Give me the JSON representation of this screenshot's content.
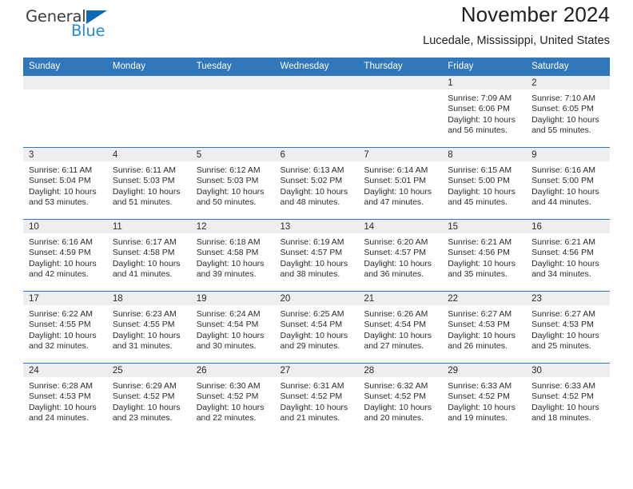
{
  "brand": {
    "word_one": "General",
    "word_two": "Blue",
    "triangle_color": "#0f6ab4",
    "blue_color": "#2a8bd5"
  },
  "header": {
    "title": "November 2024",
    "subtitle": "Lucedale, Mississippi, United States"
  },
  "theme": {
    "header_bar_color": "#3077bc",
    "daynum_bar_color": "#eeeeee",
    "row_border_color": "#2f76bb"
  },
  "calendar": {
    "day_headers": [
      "Sunday",
      "Monday",
      "Tuesday",
      "Wednesday",
      "Thursday",
      "Friday",
      "Saturday"
    ],
    "weeks": [
      [
        {
          "day": "",
          "sunrise": "",
          "sunset": "",
          "daylight": ""
        },
        {
          "day": "",
          "sunrise": "",
          "sunset": "",
          "daylight": ""
        },
        {
          "day": "",
          "sunrise": "",
          "sunset": "",
          "daylight": ""
        },
        {
          "day": "",
          "sunrise": "",
          "sunset": "",
          "daylight": ""
        },
        {
          "day": "",
          "sunrise": "",
          "sunset": "",
          "daylight": ""
        },
        {
          "day": "1",
          "sunrise": "Sunrise: 7:09 AM",
          "sunset": "Sunset: 6:06 PM",
          "daylight": "Daylight: 10 hours and 56 minutes."
        },
        {
          "day": "2",
          "sunrise": "Sunrise: 7:10 AM",
          "sunset": "Sunset: 6:05 PM",
          "daylight": "Daylight: 10 hours and 55 minutes."
        }
      ],
      [
        {
          "day": "3",
          "sunrise": "Sunrise: 6:11 AM",
          "sunset": "Sunset: 5:04 PM",
          "daylight": "Daylight: 10 hours and 53 minutes."
        },
        {
          "day": "4",
          "sunrise": "Sunrise: 6:11 AM",
          "sunset": "Sunset: 5:03 PM",
          "daylight": "Daylight: 10 hours and 51 minutes."
        },
        {
          "day": "5",
          "sunrise": "Sunrise: 6:12 AM",
          "sunset": "Sunset: 5:03 PM",
          "daylight": "Daylight: 10 hours and 50 minutes."
        },
        {
          "day": "6",
          "sunrise": "Sunrise: 6:13 AM",
          "sunset": "Sunset: 5:02 PM",
          "daylight": "Daylight: 10 hours and 48 minutes."
        },
        {
          "day": "7",
          "sunrise": "Sunrise: 6:14 AM",
          "sunset": "Sunset: 5:01 PM",
          "daylight": "Daylight: 10 hours and 47 minutes."
        },
        {
          "day": "8",
          "sunrise": "Sunrise: 6:15 AM",
          "sunset": "Sunset: 5:00 PM",
          "daylight": "Daylight: 10 hours and 45 minutes."
        },
        {
          "day": "9",
          "sunrise": "Sunrise: 6:16 AM",
          "sunset": "Sunset: 5:00 PM",
          "daylight": "Daylight: 10 hours and 44 minutes."
        }
      ],
      [
        {
          "day": "10",
          "sunrise": "Sunrise: 6:16 AM",
          "sunset": "Sunset: 4:59 PM",
          "daylight": "Daylight: 10 hours and 42 minutes."
        },
        {
          "day": "11",
          "sunrise": "Sunrise: 6:17 AM",
          "sunset": "Sunset: 4:58 PM",
          "daylight": "Daylight: 10 hours and 41 minutes."
        },
        {
          "day": "12",
          "sunrise": "Sunrise: 6:18 AM",
          "sunset": "Sunset: 4:58 PM",
          "daylight": "Daylight: 10 hours and 39 minutes."
        },
        {
          "day": "13",
          "sunrise": "Sunrise: 6:19 AM",
          "sunset": "Sunset: 4:57 PM",
          "daylight": "Daylight: 10 hours and 38 minutes."
        },
        {
          "day": "14",
          "sunrise": "Sunrise: 6:20 AM",
          "sunset": "Sunset: 4:57 PM",
          "daylight": "Daylight: 10 hours and 36 minutes."
        },
        {
          "day": "15",
          "sunrise": "Sunrise: 6:21 AM",
          "sunset": "Sunset: 4:56 PM",
          "daylight": "Daylight: 10 hours and 35 minutes."
        },
        {
          "day": "16",
          "sunrise": "Sunrise: 6:21 AM",
          "sunset": "Sunset: 4:56 PM",
          "daylight": "Daylight: 10 hours and 34 minutes."
        }
      ],
      [
        {
          "day": "17",
          "sunrise": "Sunrise: 6:22 AM",
          "sunset": "Sunset: 4:55 PM",
          "daylight": "Daylight: 10 hours and 32 minutes."
        },
        {
          "day": "18",
          "sunrise": "Sunrise: 6:23 AM",
          "sunset": "Sunset: 4:55 PM",
          "daylight": "Daylight: 10 hours and 31 minutes."
        },
        {
          "day": "19",
          "sunrise": "Sunrise: 6:24 AM",
          "sunset": "Sunset: 4:54 PM",
          "daylight": "Daylight: 10 hours and 30 minutes."
        },
        {
          "day": "20",
          "sunrise": "Sunrise: 6:25 AM",
          "sunset": "Sunset: 4:54 PM",
          "daylight": "Daylight: 10 hours and 29 minutes."
        },
        {
          "day": "21",
          "sunrise": "Sunrise: 6:26 AM",
          "sunset": "Sunset: 4:54 PM",
          "daylight": "Daylight: 10 hours and 27 minutes."
        },
        {
          "day": "22",
          "sunrise": "Sunrise: 6:27 AM",
          "sunset": "Sunset: 4:53 PM",
          "daylight": "Daylight: 10 hours and 26 minutes."
        },
        {
          "day": "23",
          "sunrise": "Sunrise: 6:27 AM",
          "sunset": "Sunset: 4:53 PM",
          "daylight": "Daylight: 10 hours and 25 minutes."
        }
      ],
      [
        {
          "day": "24",
          "sunrise": "Sunrise: 6:28 AM",
          "sunset": "Sunset: 4:53 PM",
          "daylight": "Daylight: 10 hours and 24 minutes."
        },
        {
          "day": "25",
          "sunrise": "Sunrise: 6:29 AM",
          "sunset": "Sunset: 4:52 PM",
          "daylight": "Daylight: 10 hours and 23 minutes."
        },
        {
          "day": "26",
          "sunrise": "Sunrise: 6:30 AM",
          "sunset": "Sunset: 4:52 PM",
          "daylight": "Daylight: 10 hours and 22 minutes."
        },
        {
          "day": "27",
          "sunrise": "Sunrise: 6:31 AM",
          "sunset": "Sunset: 4:52 PM",
          "daylight": "Daylight: 10 hours and 21 minutes."
        },
        {
          "day": "28",
          "sunrise": "Sunrise: 6:32 AM",
          "sunset": "Sunset: 4:52 PM",
          "daylight": "Daylight: 10 hours and 20 minutes."
        },
        {
          "day": "29",
          "sunrise": "Sunrise: 6:33 AM",
          "sunset": "Sunset: 4:52 PM",
          "daylight": "Daylight: 10 hours and 19 minutes."
        },
        {
          "day": "30",
          "sunrise": "Sunrise: 6:33 AM",
          "sunset": "Sunset: 4:52 PM",
          "daylight": "Daylight: 10 hours and 18 minutes."
        }
      ]
    ]
  }
}
